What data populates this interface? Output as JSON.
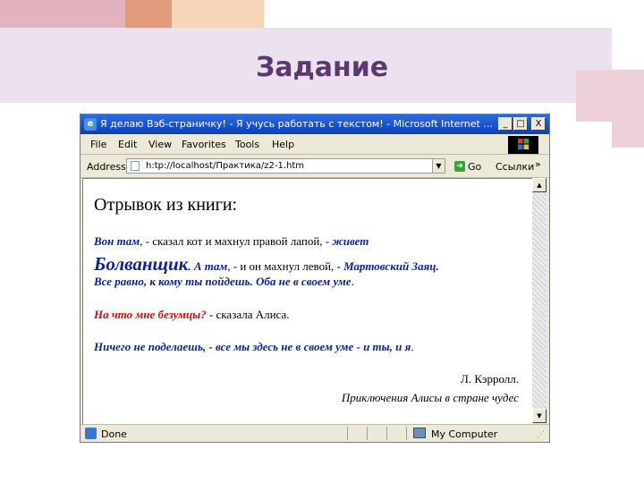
{
  "slide": {
    "title": "Задание"
  },
  "window": {
    "title": "Я делаю Вэб-страничку! - Я учусь работать с текстом! - Microsoft Internet ...",
    "min_glyph": "_",
    "max_glyph": "□",
    "close_glyph": "X"
  },
  "menu": [
    "File",
    "Edit",
    "View",
    "Favorites",
    "Tools",
    "Help"
  ],
  "address": {
    "label": "Address",
    "url": "h:tp://localhost/Практика/z2-1.htm",
    "go_label": "Go",
    "links_label": "Ссылки",
    "links_chevron": "»"
  },
  "page": {
    "heading": "Отрывок из книги:",
    "l1_a": "Вон там",
    "l1_b": ", - сказал кот и махнул правой лапой, - ",
    "l1_c": "живет",
    "l2_a": "Болванщик",
    "l2_b": ". А там",
    "l2_c": ", - и он махнул левой, - ",
    "l2_d": "Мартовский Заяц.",
    "l3": "Все равно, к кому ты пойдешь. Оба не в своем уме",
    "l3_end": ".",
    "l4_a": "На что мне безумцы?",
    "l4_b": " - сказала Алиса.",
    "l5": "Ничего не поделаешь, - все мы здесь не в своем уме - и ты, и я",
    "l5_end": ".",
    "author": "Л. Кэрролл.",
    "book": "Приключения Алисы в стране чудес"
  },
  "status": {
    "done": "Done",
    "zone": "My Computer"
  },
  "colors": {
    "link_blue": "#0b1fa0",
    "red": "#d01010",
    "title_purple": "#5a3a6e"
  }
}
